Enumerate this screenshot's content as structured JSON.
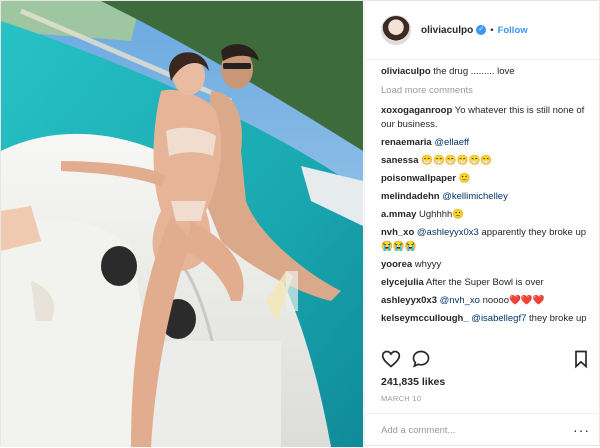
{
  "post": {
    "username": "oliviaculpo",
    "verified_icon": "verified-badge-icon",
    "separator": "•",
    "follow_label": "Follow",
    "caption": {
      "user": "oliviaculpo",
      "text": "the drug ......... love"
    },
    "load_more_label": "Load more comments",
    "comments": [
      {
        "user": "xoxogaganroop",
        "text": "Yo whatever this is still none of our business."
      },
      {
        "user": "renaemaria",
        "mention": "@ellaeff",
        "text": ""
      },
      {
        "user": "sanessa",
        "text": "😁😁😁😁😁😁"
      },
      {
        "user": "poisonwallpaper",
        "text": "🙂"
      },
      {
        "user": "melindadehn",
        "mention": "@kellimichelley",
        "text": ""
      },
      {
        "user": "a.mmay",
        "text": "Ughhhh🙂"
      },
      {
        "user": "nvh_xo",
        "mention": "@ashleyyx0x3",
        "text": "apparently they broke up 😭😭😭"
      },
      {
        "user": "yoorea",
        "text": "whyyy"
      },
      {
        "user": "elycejulia",
        "text": "After the Super Bowl is over"
      },
      {
        "user": "ashleyyx0x3",
        "mention": "@nvh_xo",
        "text": "noooo❤️❤️❤️"
      },
      {
        "user": "kelseymccullough_",
        "mention": "@isabellegf7",
        "text": "they broke up"
      }
    ],
    "likes": "241,835 likes",
    "date": "MARCH 10",
    "add_comment_placeholder": "Add a comment...",
    "more_options": "···",
    "icons": {
      "like": "heart-icon",
      "comment": "comment-icon",
      "save": "bookmark-icon"
    },
    "colors": {
      "accent": "#3897f0",
      "text": "#262626",
      "muted": "#999999"
    }
  }
}
